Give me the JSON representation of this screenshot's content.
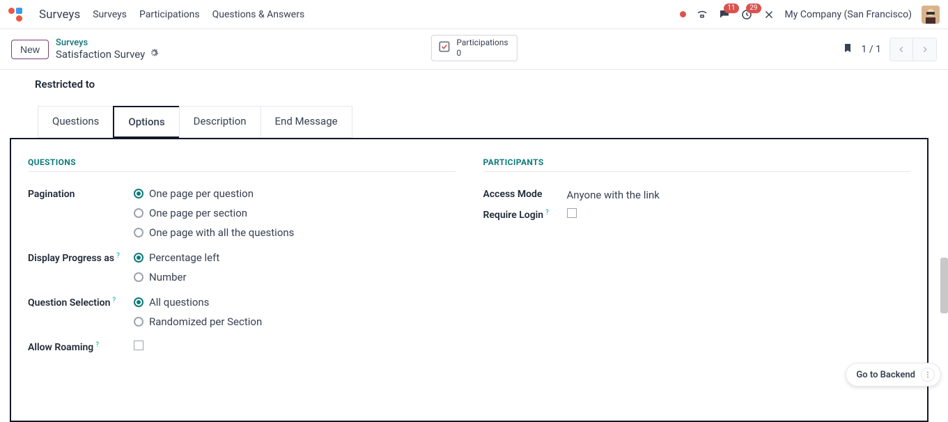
{
  "header": {
    "app_name": "Surveys",
    "menu": [
      "Surveys",
      "Participations",
      "Questions & Answers"
    ],
    "message_badge": "11",
    "activity_badge": "29",
    "company": "My Company (San Francisco)"
  },
  "controlbar": {
    "new_button": "New",
    "breadcrumb_root": "Surveys",
    "breadcrumb_title": "Satisfaction Survey",
    "stat_label": "Participations",
    "stat_value": "0",
    "pager": "1 / 1"
  },
  "content": {
    "restricted_label": "Restricted to",
    "tabs": {
      "questions": "Questions",
      "options": "Options",
      "description": "Description",
      "end_message": "End Message"
    },
    "left": {
      "section_title": "Questions",
      "pagination": {
        "label": "Pagination",
        "options": [
          "One page per question",
          "One page per section",
          "One page with all the questions"
        ],
        "selected_index": 0
      },
      "display_progress": {
        "label": "Display Progress as",
        "options": [
          "Percentage left",
          "Number"
        ],
        "selected_index": 0
      },
      "question_selection": {
        "label": "Question Selection",
        "options": [
          "All questions",
          "Randomized per Section"
        ],
        "selected_index": 0
      },
      "allow_roaming": {
        "label": "Allow Roaming"
      }
    },
    "right": {
      "section_title": "Participants",
      "access_mode": {
        "label": "Access Mode",
        "value": "Anyone with the link"
      },
      "require_login": {
        "label": "Require Login"
      }
    }
  },
  "backend_btn": "Go to Backend"
}
